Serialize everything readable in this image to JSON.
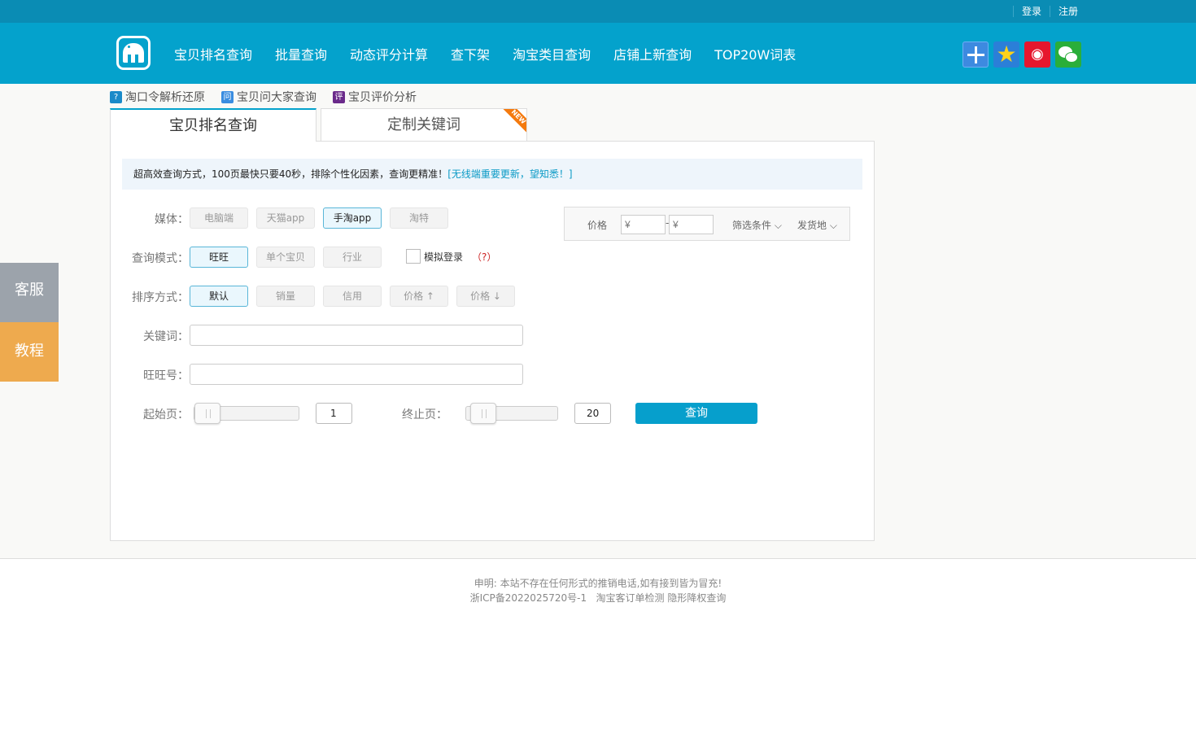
{
  "topbar": {
    "login": "登录",
    "register": "注册"
  },
  "nav": {
    "items": [
      "宝贝排名查询",
      "批量查询",
      "动态评分计算",
      "查下架",
      "淘宝类目查询",
      "店铺上新查询",
      "TOP20W词表"
    ]
  },
  "social": {
    "icons": [
      "plus-share-icon",
      "qzone-icon",
      "weibo-icon",
      "wechat-icon"
    ]
  },
  "sublinks": [
    {
      "icon_text": "?",
      "label": "淘口令解析还原",
      "color": "#1a8ac9"
    },
    {
      "icon_text": "问",
      "label": "宝贝问大家查询",
      "color": "#3a8de0"
    },
    {
      "icon_text": "评",
      "label": "宝贝评价分析",
      "color": "#6a2a8a"
    }
  ],
  "tabs": {
    "active": "宝贝排名查询",
    "second": "定制关键词",
    "badge": "NEW"
  },
  "notice": {
    "text": "超高效查询方式，100页最快只要40秒，排除个性化因素，查询更精准！",
    "link": "[无线端重要更新，望知悉！]"
  },
  "form": {
    "media_label": "媒体：",
    "media_options": [
      "电脑端",
      "天猫app",
      "手淘app",
      "淘特"
    ],
    "media_selected": "手淘app",
    "mode_label": "查询模式：",
    "mode_options": [
      "旺旺",
      "单个宝贝",
      "行业"
    ],
    "mode_selected": "旺旺",
    "simulate_login": "模拟登录",
    "help": "（?）",
    "sort_label": "排序方式：",
    "sort_options": [
      "默认",
      "销量",
      "信用",
      "价格 ↑",
      "价格 ↓"
    ],
    "sort_selected": "默认",
    "keyword_label": "关键词：",
    "keyword_value": "",
    "wangwang_label": "旺旺号：",
    "wangwang_value": "",
    "start_label": "起始页：",
    "start_value": "1",
    "end_label": "终止页：",
    "end_value": "20",
    "query_button": "查询"
  },
  "filter": {
    "price_label": "价格",
    "min_placeholder": "¥",
    "max_placeholder": "¥",
    "dash": "-",
    "conditions": "筛选条件",
    "origin": "发货地"
  },
  "side": {
    "service": "客服",
    "tutorial": "教程"
  },
  "footer": {
    "line1": "申明: 本站不存在任何形式的推销电话,如有接到皆为冒充!",
    "icp": "浙ICP备2022025720号-1",
    "link1": "淘宝客订单检测",
    "link2": "隐形降权查询"
  },
  "colors": {
    "brand": "#04a2cc",
    "topbar": "#0a8cb4",
    "tutorial": "#eeaa4e",
    "service": "#9ca3ab"
  }
}
